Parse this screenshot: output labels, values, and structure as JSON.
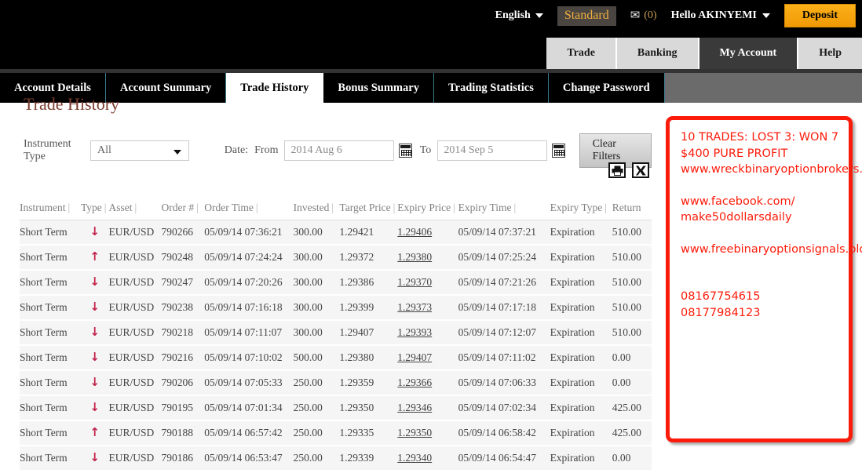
{
  "topbar": {
    "language": "English",
    "account_mode": "Standard",
    "mailbox_icon": "envelope-icon",
    "mailbox_count": "(0)",
    "greeting": "Hello AKINYEMI",
    "deposit_label": "Deposit"
  },
  "mainnav": {
    "tabs": [
      {
        "label": "Trade",
        "active": false
      },
      {
        "label": "Banking",
        "active": false
      },
      {
        "label": "My Account",
        "active": true
      },
      {
        "label": "Help",
        "active": false
      }
    ]
  },
  "subnav": {
    "tabs": [
      {
        "label": "Account Details",
        "active": false
      },
      {
        "label": "Account Summary",
        "active": false
      },
      {
        "label": "Trade History",
        "active": true
      },
      {
        "label": "Bonus Summary",
        "active": false
      },
      {
        "label": "Trading Statistics",
        "active": false
      },
      {
        "label": "Change Password",
        "active": false
      }
    ]
  },
  "page": {
    "title": "Trade History"
  },
  "filters": {
    "instrument_type_label": "Instrument Type",
    "instrument_type_value": "All",
    "date_label": "Date:",
    "from_label": "From",
    "from_value": "2014 Aug 6",
    "to_label": "To",
    "to_value": "2014 Sep 5",
    "clear_label": "Clear Filters",
    "calendar_icon": "calendar-icon",
    "print_icon": "printer-icon",
    "excel_icon": "excel-export-icon"
  },
  "table": {
    "headers": [
      "Instrument",
      "Type",
      "Asset",
      "Order #",
      "Order Time",
      "Invested",
      "Target Price",
      "Expiry Price",
      "Expiry Time",
      "Expiry Type",
      "Return"
    ],
    "rows": [
      {
        "instrument": "Short Term",
        "type": "down",
        "asset": "EUR/USD",
        "order": "790266",
        "order_time": "05/09/14 07:36:21",
        "invested": "300.00",
        "target": "1.29421",
        "expiry_price": "1.29406",
        "expiry_time": "05/09/14 07:37:21",
        "expiry_type": "Expiration",
        "return": "510.00"
      },
      {
        "instrument": "Short Term",
        "type": "up",
        "asset": "EUR/USD",
        "order": "790248",
        "order_time": "05/09/14 07:24:24",
        "invested": "300.00",
        "target": "1.29372",
        "expiry_price": "1.29380",
        "expiry_time": "05/09/14 07:25:24",
        "expiry_type": "Expiration",
        "return": "510.00"
      },
      {
        "instrument": "Short Term",
        "type": "down",
        "asset": "EUR/USD",
        "order": "790247",
        "order_time": "05/09/14 07:20:26",
        "invested": "300.00",
        "target": "1.29386",
        "expiry_price": "1.29370",
        "expiry_time": "05/09/14 07:21:26",
        "expiry_type": "Expiration",
        "return": "510.00"
      },
      {
        "instrument": "Short Term",
        "type": "down",
        "asset": "EUR/USD",
        "order": "790238",
        "order_time": "05/09/14 07:16:18",
        "invested": "300.00",
        "target": "1.29399",
        "expiry_price": "1.29373",
        "expiry_time": "05/09/14 07:17:18",
        "expiry_type": "Expiration",
        "return": "510.00"
      },
      {
        "instrument": "Short Term",
        "type": "down",
        "asset": "EUR/USD",
        "order": "790218",
        "order_time": "05/09/14 07:11:07",
        "invested": "300.00",
        "target": "1.29407",
        "expiry_price": "1.29393",
        "expiry_time": "05/09/14 07:12:07",
        "expiry_type": "Expiration",
        "return": "510.00"
      },
      {
        "instrument": "Short Term",
        "type": "down",
        "asset": "EUR/USD",
        "order": "790216",
        "order_time": "05/09/14 07:10:02",
        "invested": "500.00",
        "target": "1.29380",
        "expiry_price": "1.29407",
        "expiry_time": "05/09/14 07:11:02",
        "expiry_type": "Expiration",
        "return": "0.00"
      },
      {
        "instrument": "Short Term",
        "type": "down",
        "asset": "EUR/USD",
        "order": "790206",
        "order_time": "05/09/14 07:05:33",
        "invested": "250.00",
        "target": "1.29359",
        "expiry_price": "1.29366",
        "expiry_time": "05/09/14 07:06:33",
        "expiry_type": "Expiration",
        "return": "0.00"
      },
      {
        "instrument": "Short Term",
        "type": "down",
        "asset": "EUR/USD",
        "order": "790195",
        "order_time": "05/09/14 07:01:34",
        "invested": "250.00",
        "target": "1.29350",
        "expiry_price": "1.29346",
        "expiry_time": "05/09/14 07:02:34",
        "expiry_type": "Expiration",
        "return": "425.00"
      },
      {
        "instrument": "Short Term",
        "type": "up",
        "asset": "EUR/USD",
        "order": "790188",
        "order_time": "05/09/14 06:57:42",
        "invested": "250.00",
        "target": "1.29335",
        "expiry_price": "1.29350",
        "expiry_time": "05/09/14 06:58:42",
        "expiry_type": "Expiration",
        "return": "425.00"
      },
      {
        "instrument": "Short Term",
        "type": "down",
        "asset": "EUR/USD",
        "order": "790186",
        "order_time": "05/09/14 06:53:47",
        "invested": "250.00",
        "target": "1.29339",
        "expiry_price": "1.29340",
        "expiry_time": "05/09/14 06:54:47",
        "expiry_type": "Expiration",
        "return": "0.00"
      }
    ]
  },
  "annotation": {
    "line1": "10 TRADES: LOST 3: WON 7",
    "line2": "$400 PURE PROFIT",
    "line3": "www.wreckbinaryoptionbrokers.com/forums",
    "line4": "www.facebook.com/ make50dollarsdaily",
    "line5": "www.freebinaryoptionsignals.blogspot.com",
    "phone1": "08167754615",
    "phone2": "08177984123"
  },
  "colors": {
    "accent_orange": "#f5a60a",
    "annotation_red": "#fc1b0a",
    "arrow_red": "#c2224a",
    "nav_black": "#000000",
    "subnav_gray": "#6b6b6b"
  }
}
